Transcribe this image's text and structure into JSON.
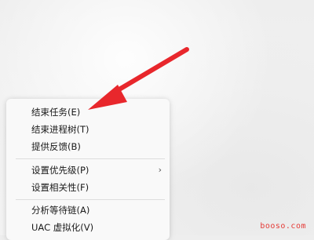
{
  "menu": {
    "items": [
      {
        "label": "结束任务(E)"
      },
      {
        "label": "结束进程树(T)"
      },
      {
        "label": "提供反馈(B)"
      },
      {
        "label": "设置优先级(P)",
        "submenu_glyph": "›"
      },
      {
        "label": "设置相关性(F)"
      },
      {
        "label": "分析等待链(A)"
      },
      {
        "label": "UAC 虚拟化(V)"
      }
    ]
  },
  "annotation": {
    "arrow_color": "#e8272c"
  },
  "watermark": {
    "text": "booso.com"
  }
}
